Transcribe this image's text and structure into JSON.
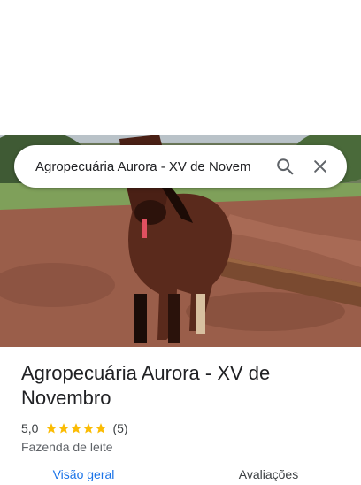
{
  "search": {
    "query": "Agropecuária Aurora - XV de Novem",
    "search_icon": "search-icon",
    "close_icon": "close-icon"
  },
  "place": {
    "photo": "horse-photo",
    "name": "Agropecuária Aurora - XV de Novembro",
    "rating": "5,0",
    "stars": 5,
    "review_count": "(5)",
    "category": "Fazenda de leite"
  },
  "tabs": [
    {
      "label": "Visão geral",
      "active": true
    },
    {
      "label": "Avaliações",
      "active": false
    }
  ],
  "colors": {
    "accent": "#1a73e8",
    "star": "#fbbc04",
    "text": "#202124"
  }
}
